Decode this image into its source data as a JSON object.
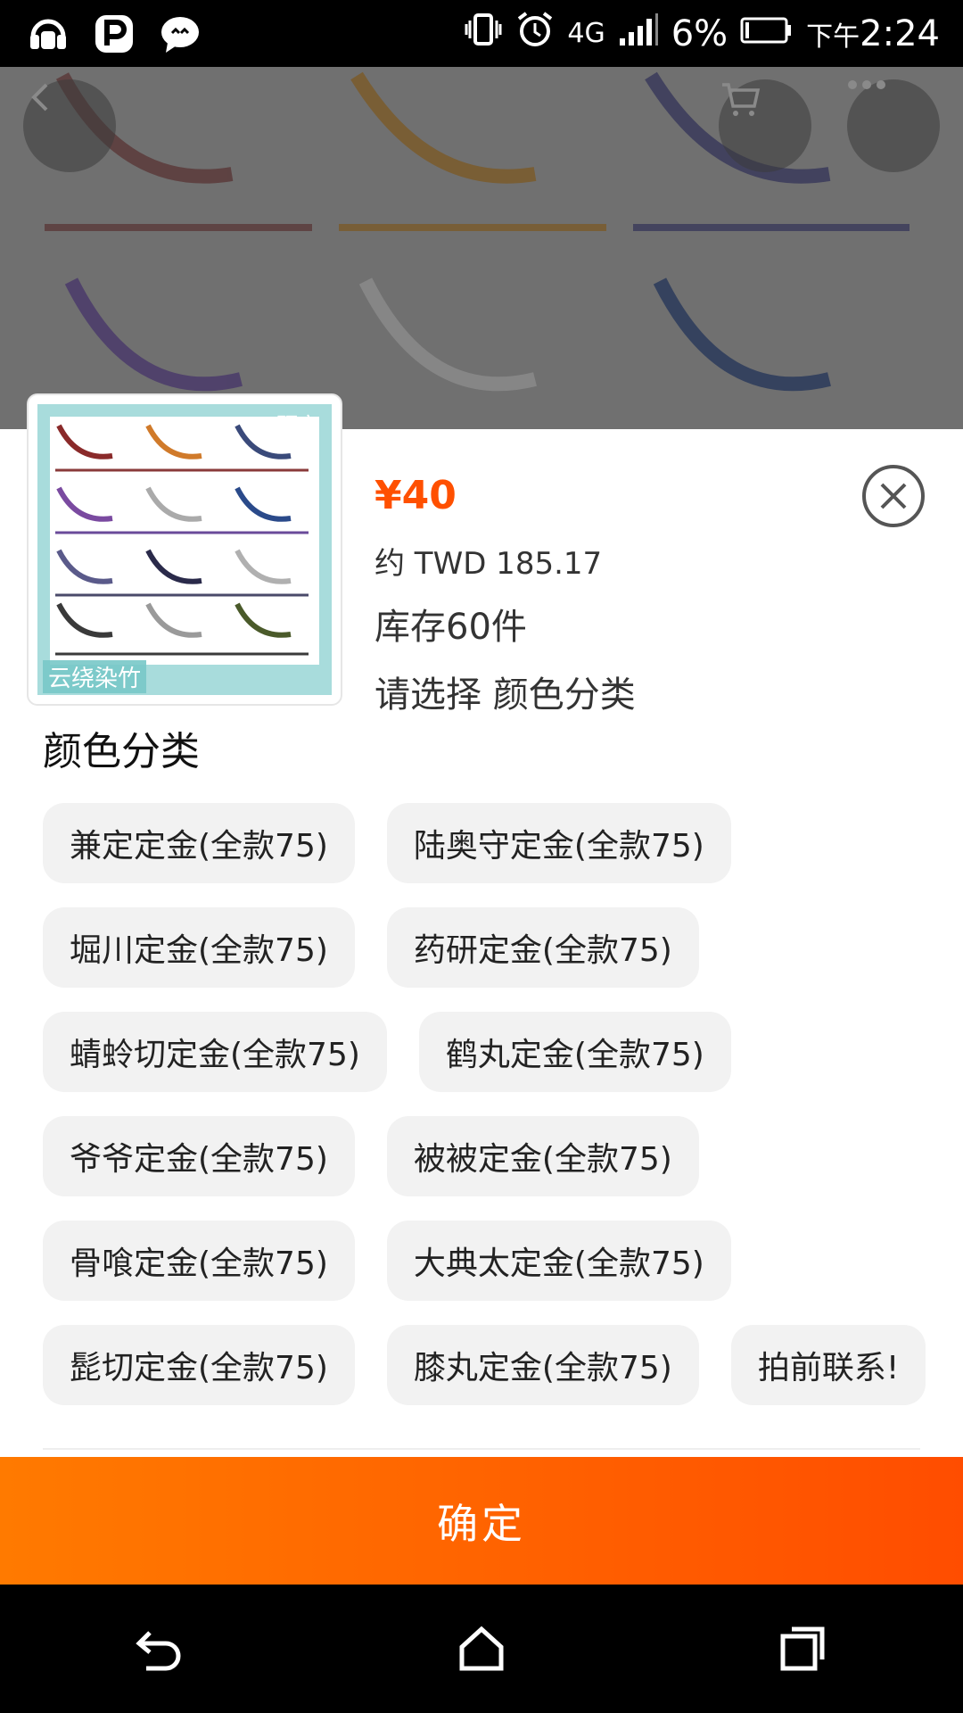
{
  "status_bar": {
    "battery_percent": "6%",
    "time_prefix": "下午",
    "time": "2:24",
    "network": "4G"
  },
  "product": {
    "price": "¥40",
    "converted_price": "约 TWD 185.17",
    "stock": "库存60件",
    "selection_hint": "请选择 颜色分类",
    "thumbnail_tag_top": "预定",
    "thumbnail_tag_bottom": "云绕染竹"
  },
  "options": {
    "group_title": "颜色分类",
    "rows": [
      [
        "兼定定金(全款75)",
        "陆奥守定金(全款75)"
      ],
      [
        "堀川定金(全款75)",
        "药研定金(全款75)"
      ],
      [
        "蜻蛉切定金(全款75)",
        "鹤丸定金(全款75)"
      ],
      [
        "爷爷定金(全款75)",
        "被被定金(全款75)"
      ],
      [
        "骨喰定金(全款75)",
        "大典太定金(全款75)"
      ],
      [
        "髭切定金(全款75)",
        "膝丸定金(全款75)",
        "拍前联系!"
      ]
    ]
  },
  "actions": {
    "confirm_label": "确定"
  },
  "colors": {
    "accent": "#ff5000",
    "chip_bg": "#f2f2f2",
    "button_gradient_start": "#ff7a00",
    "button_gradient_end": "#ff4d00"
  },
  "icons": [
    "back-icon",
    "cart-icon",
    "more-icon",
    "close-icon",
    "nav-back-icon",
    "nav-home-icon",
    "nav-recents-icon"
  ]
}
